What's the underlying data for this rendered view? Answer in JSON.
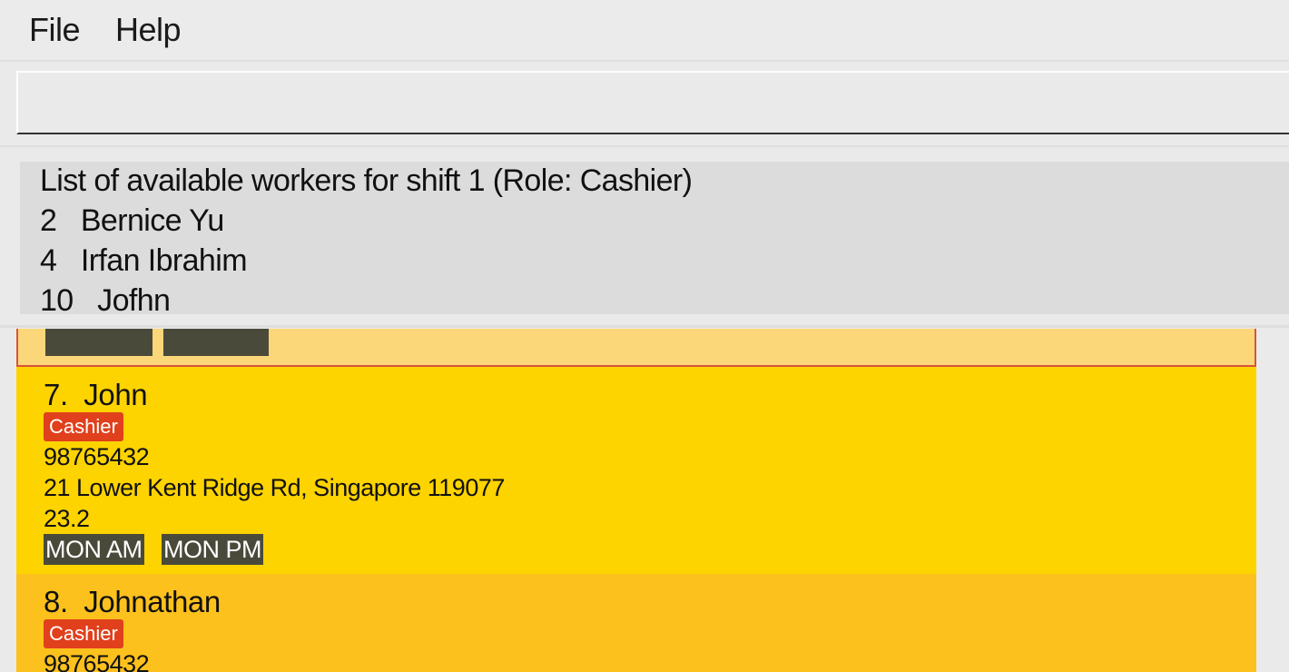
{
  "menu": {
    "file": "File",
    "help": "Help"
  },
  "command_box": {
    "value": "",
    "placeholder": ""
  },
  "result": {
    "header": "List of available workers for shift 1 (Role: Cashier)",
    "workers": [
      {
        "index": "2",
        "name": "Bernice Yu"
      },
      {
        "index": "4",
        "name": "Irfan Ibrahim"
      },
      {
        "index": "10",
        "name": "Jofhn"
      }
    ]
  },
  "cards": [
    {
      "number": "7.",
      "name": "John",
      "role": "Cashier",
      "phone": "98765432",
      "address": "21 Lower Kent Ridge Rd, Singapore 119077",
      "pay": "23.2",
      "shifts": [
        "MON AM",
        "MON PM"
      ]
    },
    {
      "number": "8.",
      "name": "Johnathan",
      "role": "Cashier",
      "phone": "98765432"
    }
  ],
  "colors": {
    "card_selected_border": "#d9533a",
    "card_primary": "#fdd300",
    "card_secondary": "#fdc11d",
    "role_tag": "#e0401c",
    "shift_tag": "#4a4a3a"
  }
}
